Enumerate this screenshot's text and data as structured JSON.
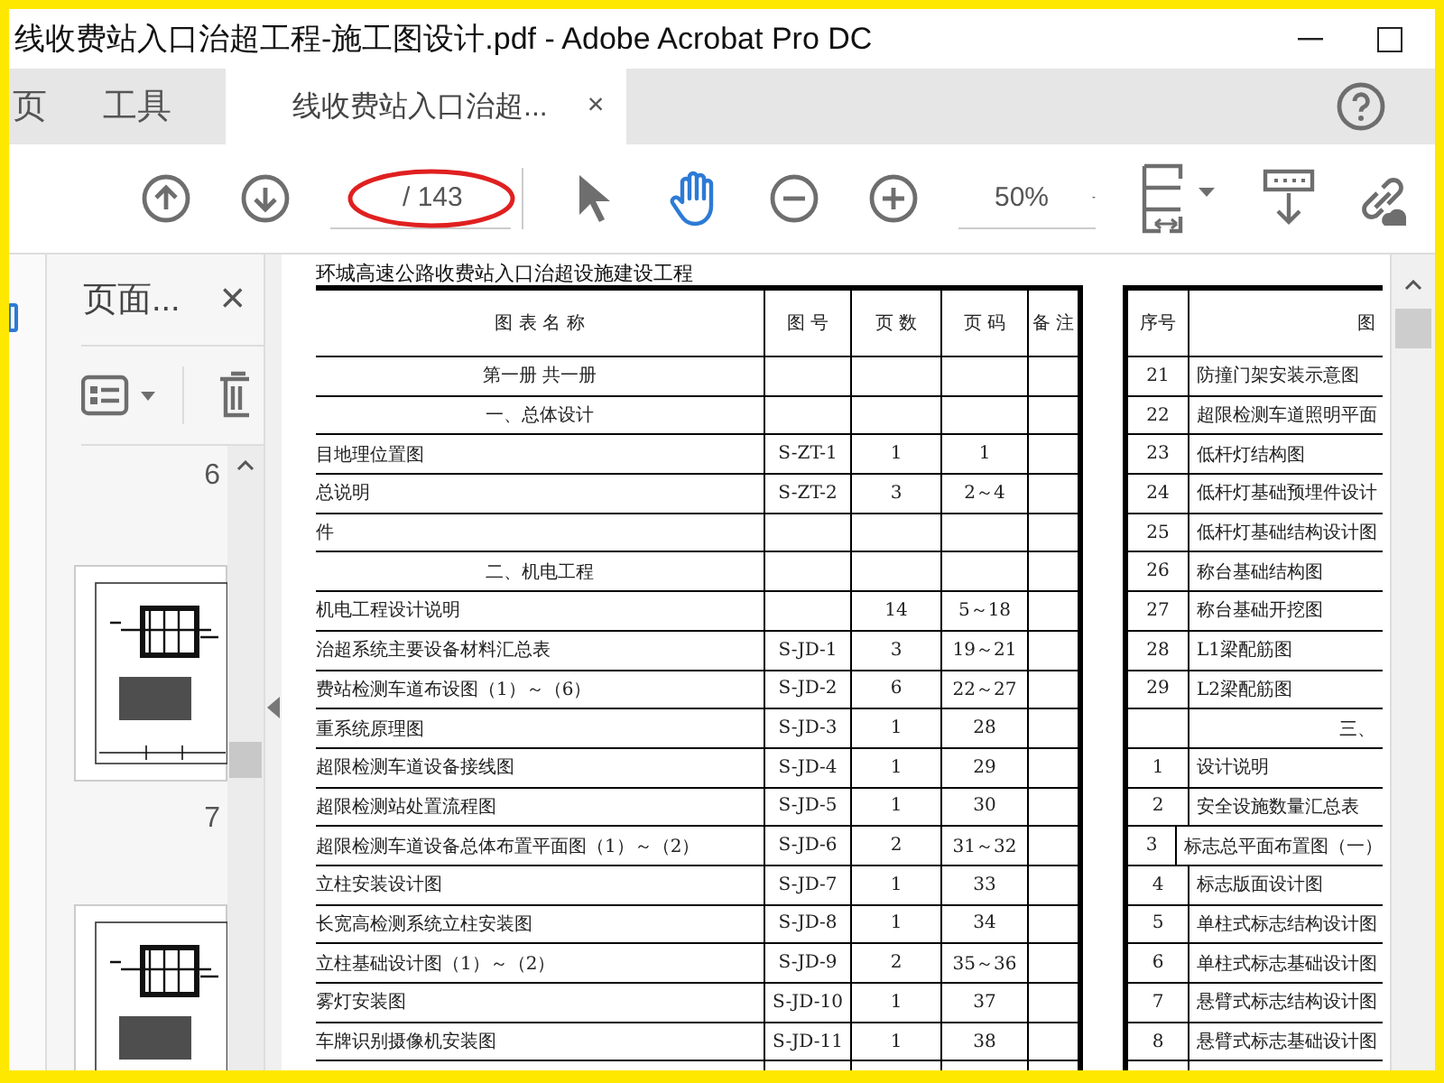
{
  "window": {
    "title": "线收费站入口治超工程-施工图设计.pdf - Adobe Acrobat Pro DC"
  },
  "tabs": [
    {
      "label": "页",
      "selected": false
    },
    {
      "label": "工具",
      "selected": false
    },
    {
      "label": "线收费站入口治超...",
      "selected": true,
      "close": "×"
    }
  ],
  "toolbar": {
    "nav": [
      {
        "kind": "previous"
      },
      {
        "kind": "next"
      }
    ],
    "page_total": "/ 143",
    "tools": [
      {
        "kind": "select",
        "selected": false
      },
      {
        "kind": "hand",
        "selected": true
      }
    ],
    "zoom": "50%"
  },
  "pages_panel": {
    "title": "页面...",
    "close": "×",
    "thumbnails": [
      {
        "label": "6"
      },
      {
        "label": "7"
      }
    ]
  },
  "document": {
    "heading": "环城高速公路收费站入口治超设施建设工程",
    "table": {
      "columns": [
        "图 表 名 称",
        "图 号",
        "页 数",
        "页 码",
        "备 注"
      ],
      "rows": [
        {
          "kind": "section",
          "name": "第一册  共一册"
        },
        {
          "kind": "section",
          "name": "一、总体设计"
        },
        {
          "kind": "item",
          "name": "目地理位置图",
          "drawing": "S-ZT-1",
          "pages": "1",
          "range": "1"
        },
        {
          "kind": "item",
          "name": "总说明",
          "drawing": "S-ZT-2",
          "pages": "3",
          "range": "2～4"
        },
        {
          "kind": "item",
          "name": "件"
        },
        {
          "kind": "section",
          "name": "二、机电工程"
        },
        {
          "kind": "item",
          "name": "机电工程设计说明",
          "pages": "14",
          "range": "5～18"
        },
        {
          "kind": "item",
          "name": "治超系统主要设备材料汇总表",
          "drawing": "S-JD-1",
          "pages": "3",
          "range": "19～21"
        },
        {
          "kind": "item",
          "name": "费站检测车道布设图（1）～（6）",
          "drawing": "S-JD-2",
          "pages": "6",
          "range": "22～27"
        },
        {
          "kind": "item",
          "name": "重系统原理图",
          "drawing": "S-JD-3",
          "pages": "1",
          "range": "28"
        },
        {
          "kind": "item",
          "name": "超限检测车道设备接线图",
          "drawing": "S-JD-4",
          "pages": "1",
          "range": "29"
        },
        {
          "kind": "item",
          "name": "超限检测站处置流程图",
          "drawing": "S-JD-5",
          "pages": "1",
          "range": "30"
        },
        {
          "kind": "item",
          "name": "超限检测车道设备总体布置平面图（1）～（2）",
          "drawing": "S-JD-6",
          "pages": "2",
          "range": "31～32"
        },
        {
          "kind": "item",
          "name": "立柱安装设计图",
          "drawing": "S-JD-7",
          "pages": "1",
          "range": "33"
        },
        {
          "kind": "item",
          "name": "长宽高检测系统立柱安装图",
          "drawing": "S-JD-8",
          "pages": "1",
          "range": "34"
        },
        {
          "kind": "item",
          "name": "立柱基础设计图（1）～（2）",
          "drawing": "S-JD-9",
          "pages": "2",
          "range": "35～36"
        },
        {
          "kind": "item",
          "name": "雾灯安装图",
          "drawing": "S-JD-10",
          "pages": "1",
          "range": "37"
        },
        {
          "kind": "item",
          "name": "车牌识别摄像机安装图",
          "drawing": "S-JD-11",
          "pages": "1",
          "range": "38"
        }
      ]
    },
    "table_2": {
      "columns": [
        "序号",
        "图"
      ],
      "rows": [
        {
          "kind": "item",
          "no": "21",
          "name": "防撞门架安装示意图"
        },
        {
          "kind": "item",
          "no": "22",
          "name": "超限检测车道照明平面"
        },
        {
          "kind": "item",
          "no": "23",
          "name": "低杆灯结构图"
        },
        {
          "kind": "item",
          "no": "24",
          "name": "低杆灯基础预埋件设计"
        },
        {
          "kind": "item",
          "no": "25",
          "name": "低杆灯基础结构设计图"
        },
        {
          "kind": "item",
          "no": "26",
          "name": "称台基础结构图"
        },
        {
          "kind": "item",
          "no": "27",
          "name": "称台基础开挖图"
        },
        {
          "kind": "item",
          "no": "28",
          "name": "L1梁配筋图"
        },
        {
          "kind": "item",
          "no": "29",
          "name": "L2梁配筋图"
        },
        {
          "kind": "section",
          "name": "三、"
        },
        {
          "kind": "item",
          "no": "1",
          "name": "设计说明"
        },
        {
          "kind": "item",
          "no": "2",
          "name": "安全设施数量汇总表"
        },
        {
          "kind": "item",
          "no": "3",
          "name": "标志总平面布置图（一）"
        },
        {
          "kind": "item",
          "no": "4",
          "name": "标志版面设计图"
        },
        {
          "kind": "item",
          "no": "5",
          "name": "单柱式标志结构设计图"
        },
        {
          "kind": "item",
          "no": "6",
          "name": "单柱式标志基础设计图"
        },
        {
          "kind": "item",
          "no": "7",
          "name": "悬臂式标志结构设计图"
        },
        {
          "kind": "item",
          "no": "8",
          "name": "悬臂式标志基础设计图"
        }
      ]
    }
  }
}
